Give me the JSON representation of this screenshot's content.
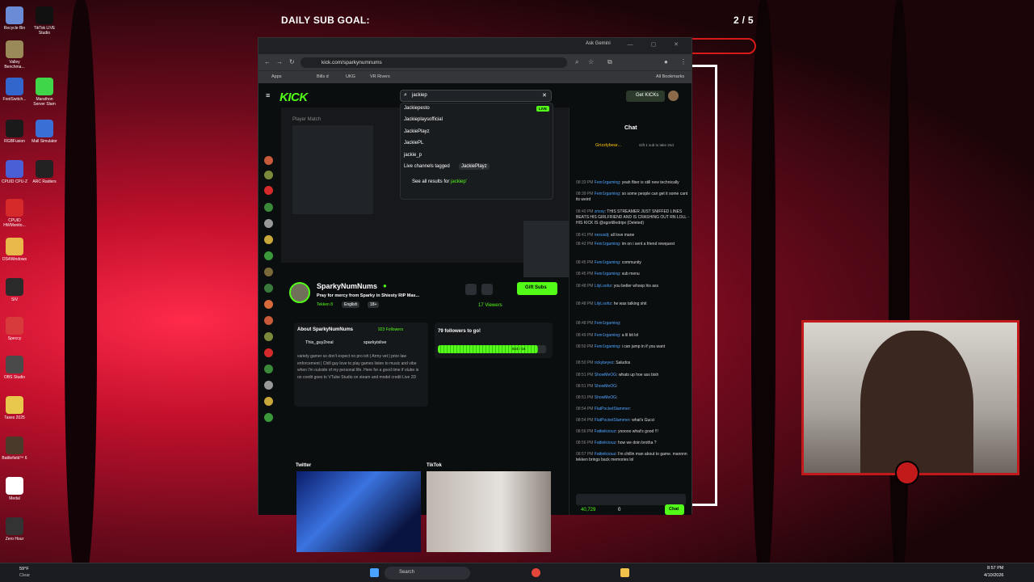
{
  "overlay": {
    "goal_title": "DAILY SUB GOAL:",
    "goal_count": "2 / 5"
  },
  "desktop": [
    "Recycle Bin",
    "TikTok LIVE Studio",
    "Valley Benchma...",
    "FootSwitch...",
    "Marathon Server Slam",
    "RGBFusion",
    "Mall Simulator",
    "CPUID CPU-Z",
    "ARC Raiders",
    "CPUID HWMonito...",
    "DS4Windows",
    "SIV",
    "Speccy",
    "OBS Studio",
    "Taxes 2025",
    "Battlefield™ 6",
    "Medal",
    "Zero Hour"
  ],
  "browser": {
    "gemini": "Ask Gemini",
    "url": "kick.com/sparkynumnums",
    "bookmarks": [
      "Apps",
      "Bills d",
      "UKG",
      "VR Rivers",
      "All Bookmarks"
    ]
  },
  "kick": {
    "search_value": "jackiep",
    "suggestions": [
      "Jackiepesto",
      "Jackieplaysofficial",
      "JackiePlayz",
      "JackiePL",
      "jackie_p"
    ],
    "live_badge": "LIVE",
    "tagged_label": "Live channels tagged",
    "tagged_value": "JackiePlayz",
    "see_all": "See all results for",
    "see_all_q": "jackiep'",
    "get_kicks": "Get KICKs",
    "player_title": "Player Match",
    "channel": "SparkyNumNums",
    "stream_title": "Pray for mercy from Sparky in Shiesty RIP Mas...",
    "tags": [
      "Tekken 8",
      "English",
      "18+"
    ],
    "gift": "Gift Subs",
    "viewers": "17 Viewers",
    "about_title": "About SparkyNumNums",
    "followers": "923 Followers",
    "socials": [
      "This_guy2real",
      "sparkyislive"
    ],
    "bio": "variety gamer so don't expect no pro ish | Army vet | prior law enforcement | Chill guy love to play games listen to music and vibe when I'm outside of my personal life. Here for a good time if vtube is on credit goes to VTube Studio on steam and model credit Live 2D",
    "goal_text": "79 followers to go!",
    "goal_progress": "924 / 1K",
    "twitter": "Twitter",
    "tiktok": "TikTok"
  },
  "chat": {
    "title": "Chat",
    "pinned_user": "Grizzlybear...",
    "pinned_note": "Gift 1 sub to take 2nd",
    "messages": [
      {
        "t": "08:33 PM",
        "u": "Fenr1rgaming",
        "m": "yeah fiber is still new technically"
      },
      {
        "t": "08:39 PM",
        "u": "Fenr1rgaming",
        "m": "so some people can get it some cant its weird"
      },
      {
        "t": "08:40 PM",
        "u": "zrixxy",
        "m": "THIS STREAMER JUST SNIFFED LINES BEATS HIS GIRLFRIEND AND IS CRASHING OUT RN LOLL - HIS KICK IS @sgortilledripx (Deleted)"
      },
      {
        "t": "08:41 PM",
        "u": "nexusdj",
        "m": "all love mane"
      },
      {
        "t": "08:42 PM",
        "u": "Fenr1rgaming",
        "m": "im on i sent a friend rewquest"
      },
      {
        "t": "08:45 PM",
        "u": "Fenr1rgaming",
        "m": "community"
      },
      {
        "t": "08:45 PM",
        "u": "Fenr1rgaming",
        "m": "sub menu"
      },
      {
        "t": "08:48 PM",
        "u": "LilyLoohz",
        "m": "you better whoop his ass"
      },
      {
        "t": "08:48 PM",
        "u": "LilyLoohz",
        "m": "he was talking shit"
      },
      {
        "t": "08:48 PM",
        "u": "Fenr1rgaming",
        "m": ""
      },
      {
        "t": "08:49 PM",
        "u": "Fenr1rgaming",
        "m": "a lil bit lol"
      },
      {
        "t": "08:50 PM",
        "u": "Fenr1rgaming",
        "m": "i can jump in if you want"
      },
      {
        "t": "08:50 PM",
        "u": "rickybeyez",
        "m": "Saludos"
      },
      {
        "t": "08:51 PM",
        "u": "ShowMeOG",
        "m": "whats up hoe ass bish"
      },
      {
        "t": "08:51 PM",
        "u": "ShowMeOG",
        "m": ""
      },
      {
        "t": "08:51 PM",
        "u": "ShowMeOG",
        "m": ""
      },
      {
        "t": "08:54 PM",
        "u": "FlatPocketSlammer",
        "m": ""
      },
      {
        "t": "08:54 PM",
        "u": "FlatPocketSlammer",
        "m": "what's Gucci"
      },
      {
        "t": "08:56 PM",
        "u": "Fattieliciouz",
        "m": "yooooo what's good !!!"
      },
      {
        "t": "08:56 PM",
        "u": "Fattieliciouz",
        "m": "how we doin brotha ?"
      },
      {
        "t": "08:57 PM",
        "u": "Fattieliciouz",
        "m": "I'm chillin man about to game. mannnn tekken brings back memories lol"
      }
    ],
    "kicks_count": "40,729",
    "zero": "0",
    "chat_btn": "Chat"
  },
  "taskbar": {
    "weather_temp": "59°F",
    "weather_desc": "Clear",
    "search": "Search",
    "time": "8:57 PM",
    "date": "4/10/2026"
  }
}
